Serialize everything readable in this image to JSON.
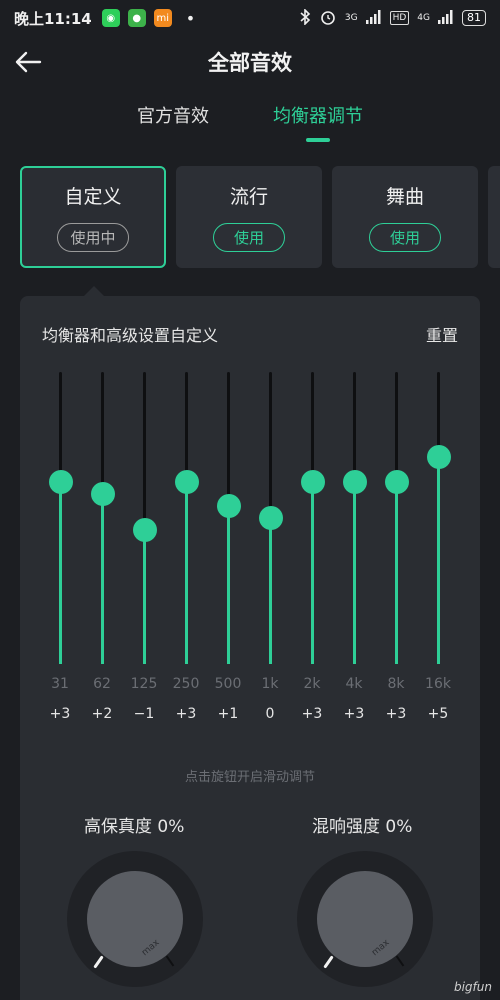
{
  "status_bar": {
    "time": "晚上11:14",
    "apps": [
      {
        "icon": "wechat-icon",
        "color": "#2ecf5a",
        "glyph": "◉"
      },
      {
        "icon": "lemon-app-icon",
        "color": "#3db24a",
        "glyph": "●"
      },
      {
        "icon": "mi-app-icon",
        "color": "#f28a1f",
        "glyph": "mi"
      }
    ],
    "dot": "•",
    "signal_1": "3G",
    "hd": "HD",
    "signal_2": "4G",
    "battery": "81"
  },
  "header": {
    "title": "全部音效"
  },
  "tabs": [
    {
      "label": "官方音效",
      "active": false
    },
    {
      "label": "均衡器调节",
      "active": true
    }
  ],
  "presets": [
    {
      "name": "自定义",
      "action": "使用中",
      "selected": true
    },
    {
      "name": "流行",
      "action": "使用",
      "selected": false
    },
    {
      "name": "舞曲",
      "action": "使用",
      "selected": false
    }
  ],
  "equalizer": {
    "title": "均衡器和高级设置自定义",
    "reset": "重置",
    "range_db": [
      -12,
      12
    ],
    "bands": [
      {
        "freq": "31",
        "gain_label": "+3",
        "gain": 3
      },
      {
        "freq": "62",
        "gain_label": "+2",
        "gain": 2
      },
      {
        "freq": "125",
        "gain_label": "−1",
        "gain": -1
      },
      {
        "freq": "250",
        "gain_label": "+3",
        "gain": 3
      },
      {
        "freq": "500",
        "gain_label": "+1",
        "gain": 1
      },
      {
        "freq": "1k",
        "gain_label": "0",
        "gain": 0
      },
      {
        "freq": "2k",
        "gain_label": "+3",
        "gain": 3
      },
      {
        "freq": "4k",
        "gain_label": "+3",
        "gain": 3
      },
      {
        "freq": "8k",
        "gain_label": "+3",
        "gain": 3
      },
      {
        "freq": "16k",
        "gain_label": "+5",
        "gain": 5
      }
    ],
    "hint": "点击旋钮开启滑动调节"
  },
  "dials": [
    {
      "label": "高保真度 0%",
      "max_label": "max",
      "value": 0
    },
    {
      "label": "混响强度 0%",
      "max_label": "max",
      "value": 0
    }
  ],
  "watermark": "bigfun",
  "colors": {
    "accent": "#2ecf97",
    "background": "#1c1e22",
    "panel": "#2a2d32"
  }
}
